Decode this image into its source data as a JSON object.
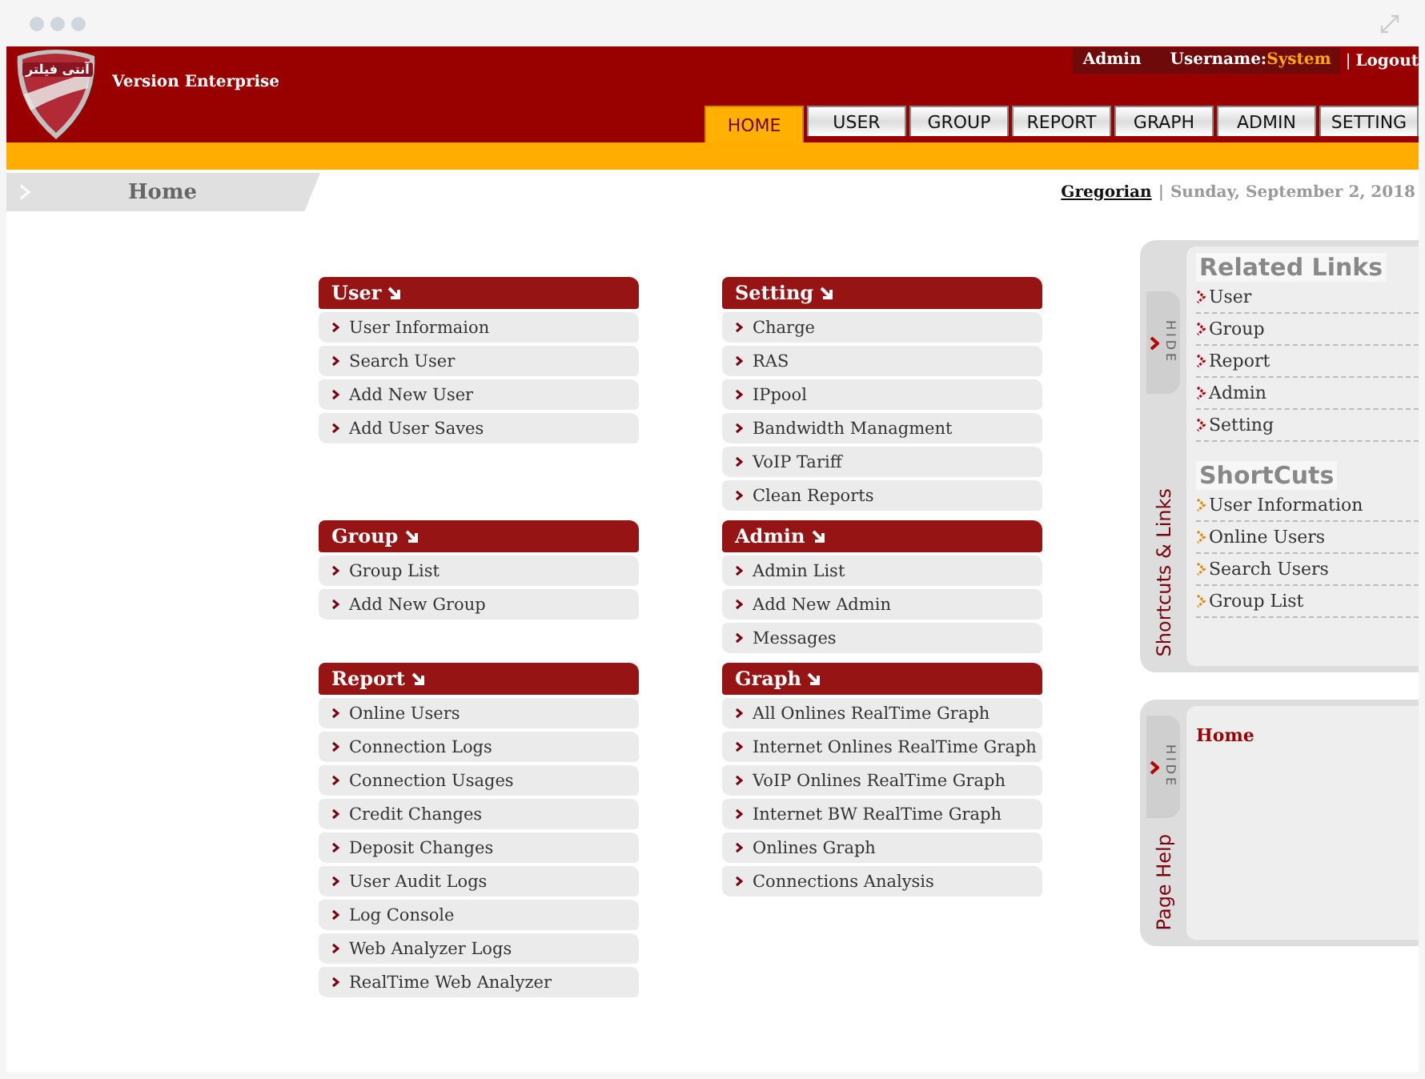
{
  "header": {
    "logo_text": "آنتی فیلتر",
    "version": "Version Enterprise",
    "role": "Admin",
    "user_label": "Username:",
    "user_value": "System",
    "separator": "|",
    "logout": "Logout"
  },
  "tabs": [
    {
      "label": "HOME",
      "selected": true
    },
    {
      "label": "USER",
      "selected": false
    },
    {
      "label": "GROUP",
      "selected": false
    },
    {
      "label": "REPORT",
      "selected": false
    },
    {
      "label": "GRAPH",
      "selected": false
    },
    {
      "label": "ADMIN",
      "selected": false
    },
    {
      "label": "SETTING",
      "selected": false
    }
  ],
  "breadcrumb": {
    "title": "Home"
  },
  "date_bar": {
    "calendar": "Gregorian",
    "separator": "|",
    "date": "Sunday, September 2, 2018"
  },
  "sections": [
    {
      "title": "User",
      "items": [
        "User Informaion",
        "Search User",
        "Add New User",
        "Add User Saves"
      ]
    },
    {
      "title": "Setting",
      "items": [
        "Charge",
        "RAS",
        "IPpool",
        "Bandwidth Managment",
        "VoIP Tariff",
        "Clean Reports"
      ]
    },
    {
      "title": "Group",
      "items": [
        "Group List",
        "Add New Group"
      ]
    },
    {
      "title": "Admin",
      "items": [
        "Admin List",
        "Add New Admin",
        "Messages"
      ]
    },
    {
      "title": "Report",
      "items": [
        "Online Users",
        "Connection Logs",
        "Connection Usages",
        "Credit Changes",
        "Deposit Changes",
        "User Audit Logs",
        "Log Console",
        "Web Analyzer Logs",
        "RealTime Web Analyzer"
      ]
    },
    {
      "title": "Graph",
      "items": [
        "All Onlines RealTime Graph",
        "Internet Onlines RealTime Graph",
        "VoIP Onlines RealTime Graph",
        "Internet BW RealTime Graph",
        "Onlines Graph",
        "Connections Analysis"
      ]
    }
  ],
  "sidebar": {
    "links_panel": {
      "tab_label": "Shortcuts & Links",
      "hide_label": "HIDE",
      "groups": [
        {
          "title": "Related Links",
          "kind": "related",
          "items": [
            "User",
            "Group",
            "Report",
            "Admin",
            "Setting"
          ]
        },
        {
          "title": "ShortCuts",
          "kind": "shortcut",
          "items": [
            "User Information",
            "Online Users",
            "Search Users",
            "Group List"
          ]
        }
      ]
    },
    "help_panel": {
      "tab_label": "Page Help",
      "hide_label": "HIDE",
      "text": "Home"
    }
  }
}
